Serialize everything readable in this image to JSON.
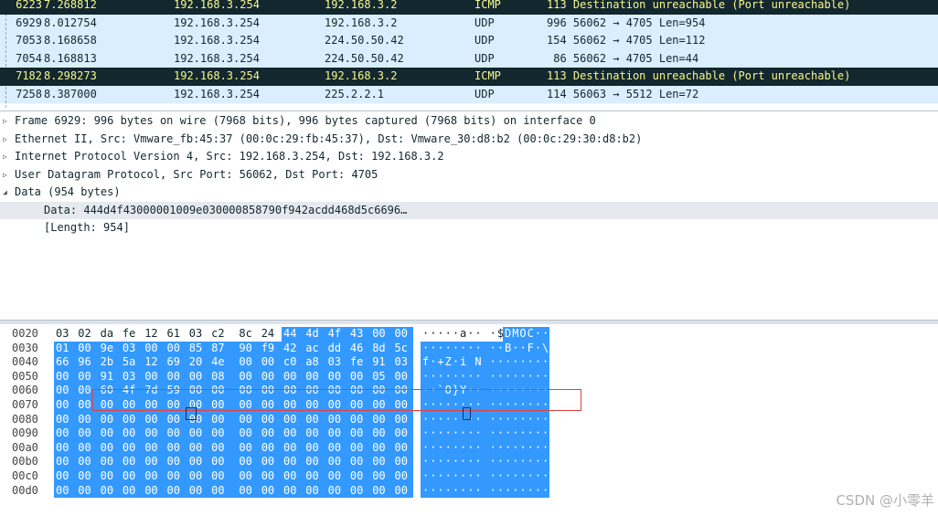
{
  "packet_list": [
    {
      "no": "6223",
      "time": "7.268812",
      "src": "192.168.3.254",
      "dst": "192.168.3.2",
      "proto": "ICMP",
      "len": "113",
      "info": "Destination unreachable (Port unreachable)",
      "kind": "icmp"
    },
    {
      "no": "6929",
      "time": "8.012754",
      "src": "192.168.3.254",
      "dst": "192.168.3.2",
      "proto": "UDP",
      "len": "996",
      "info": "56062 → 4705 Len=954",
      "kind": "udp"
    },
    {
      "no": "7053",
      "time": "8.168658",
      "src": "192.168.3.254",
      "dst": "224.50.50.42",
      "proto": "UDP",
      "len": "154",
      "info": "56062 → 4705 Len=112",
      "kind": "udp"
    },
    {
      "no": "7054",
      "time": "8.168813",
      "src": "192.168.3.254",
      "dst": "224.50.50.42",
      "proto": "UDP",
      "len": " 86",
      "info": "56062 → 4705 Len=44",
      "kind": "udp"
    },
    {
      "no": "7182",
      "time": "8.298273",
      "src": "192.168.3.254",
      "dst": "192.168.3.2",
      "proto": "ICMP",
      "len": "113",
      "info": "Destination unreachable (Port unreachable)",
      "kind": "icmp"
    },
    {
      "no": "7258",
      "time": "8.387000",
      "src": "192.168.3.254",
      "dst": "225.2.2.1",
      "proto": "UDP",
      "len": "114",
      "info": "56063 → 5512 Len=72",
      "kind": "udp"
    }
  ],
  "details": [
    {
      "text": "Frame 6929: 996 bytes on wire (7968 bits), 996 bytes captured (7968 bits) on interface 0",
      "expander": "▷",
      "child": false
    },
    {
      "text": "Ethernet II, Src: Vmware_fb:45:37 (00:0c:29:fb:45:37), Dst: Vmware_30:d8:b2 (00:0c:29:30:d8:b2)",
      "expander": "▷",
      "child": false
    },
    {
      "text": "Internet Protocol Version 4, Src: 192.168.3.254, Dst: 192.168.3.2",
      "expander": "▷",
      "child": false
    },
    {
      "text": "User Datagram Protocol, Src Port: 56062, Dst Port: 4705",
      "expander": "▷",
      "child": false
    },
    {
      "text": "Data (954 bytes)",
      "expander": "◢",
      "child": false
    },
    {
      "text": "Data: 444d4f43000001009e030000858790f942acdd468d5c6696…",
      "expander": "",
      "child": true,
      "highlight": true
    },
    {
      "text": "[Length: 954]",
      "expander": "",
      "child": true
    }
  ],
  "bytes": [
    {
      "offset": "0020",
      "hex": [
        "03",
        "02",
        "da",
        "fe",
        "12",
        "61",
        "03",
        "c2",
        "8c",
        "24",
        "44",
        "4d",
        "4f",
        "43",
        "00",
        "00"
      ],
      "ascii": [
        "·",
        "·",
        "·",
        "·",
        "·",
        "a",
        "·",
        "·",
        "·",
        "$",
        "D",
        "M",
        "O",
        "C",
        "·",
        "·"
      ],
      "sel_from": 10
    },
    {
      "offset": "0030",
      "hex": [
        "01",
        "00",
        "9e",
        "03",
        "00",
        "00",
        "85",
        "87",
        "90",
        "f9",
        "42",
        "ac",
        "dd",
        "46",
        "8d",
        "5c"
      ],
      "ascii": [
        "·",
        "·",
        "·",
        "·",
        "·",
        "·",
        "·",
        "·",
        "·",
        "·",
        "B",
        "·",
        "·",
        "F",
        "·",
        "\\"
      ],
      "sel_from": 0
    },
    {
      "offset": "0040",
      "hex": [
        "66",
        "96",
        "2b",
        "5a",
        "12",
        "69",
        "20",
        "4e",
        "00",
        "00",
        "c0",
        "a8",
        "03",
        "fe",
        "91",
        "03"
      ],
      "ascii": [
        "f",
        "·",
        "+",
        "Z",
        "·",
        "i",
        " ",
        "N",
        "·",
        "·",
        "·",
        "·",
        "·",
        "·",
        "·",
        "·"
      ],
      "sel_from": 0
    },
    {
      "offset": "0050",
      "hex": [
        "00",
        "00",
        "91",
        "03",
        "00",
        "00",
        "00",
        "08",
        "00",
        "00",
        "00",
        "00",
        "00",
        "00",
        "05",
        "00"
      ],
      "ascii": [
        "·",
        "·",
        "·",
        "·",
        "·",
        "·",
        "·",
        "·",
        "·",
        "·",
        "·",
        "·",
        "·",
        "·",
        "·",
        "·"
      ],
      "sel_from": 0
    },
    {
      "offset": "0060",
      "hex": [
        "00",
        "00",
        "60",
        "4f",
        "7d",
        "59",
        "00",
        "00",
        "00",
        "00",
        "00",
        "00",
        "00",
        "00",
        "00",
        "00"
      ],
      "ascii": [
        "·",
        "·",
        "`",
        "O",
        "}",
        "Y",
        "·",
        "·",
        "·",
        "·",
        "·",
        "·",
        "·",
        "·",
        "·",
        "·"
      ],
      "sel_from": 0
    },
    {
      "offset": "0070",
      "hex": [
        "00",
        "00",
        "00",
        "00",
        "00",
        "00",
        "00",
        "00",
        "00",
        "00",
        "00",
        "00",
        "00",
        "00",
        "00",
        "00"
      ],
      "ascii": [
        "·",
        "·",
        "·",
        "·",
        "·",
        "·",
        "·",
        "·",
        "·",
        "·",
        "·",
        "·",
        "·",
        "·",
        "·",
        "·"
      ],
      "sel_from": 0
    },
    {
      "offset": "0080",
      "hex": [
        "00",
        "00",
        "00",
        "00",
        "00",
        "00",
        "00",
        "00",
        "00",
        "00",
        "00",
        "00",
        "00",
        "00",
        "00",
        "00"
      ],
      "ascii": [
        "·",
        "·",
        "·",
        "·",
        "·",
        "·",
        "·",
        "·",
        "·",
        "·",
        "·",
        "·",
        "·",
        "·",
        "·",
        "·"
      ],
      "sel_from": 0
    },
    {
      "offset": "0090",
      "hex": [
        "00",
        "00",
        "00",
        "00",
        "00",
        "00",
        "00",
        "00",
        "00",
        "00",
        "00",
        "00",
        "00",
        "00",
        "00",
        "00"
      ],
      "ascii": [
        "·",
        "·",
        "·",
        "·",
        "·",
        "·",
        "·",
        "·",
        "·",
        "·",
        "·",
        "·",
        "·",
        "·",
        "·",
        "·"
      ],
      "sel_from": 0
    },
    {
      "offset": "00a0",
      "hex": [
        "00",
        "00",
        "00",
        "00",
        "00",
        "00",
        "00",
        "00",
        "00",
        "00",
        "00",
        "00",
        "00",
        "00",
        "00",
        "00"
      ],
      "ascii": [
        "·",
        "·",
        "·",
        "·",
        "·",
        "·",
        "·",
        "·",
        "·",
        "·",
        "·",
        "·",
        "·",
        "·",
        "·",
        "·"
      ],
      "sel_from": 0
    },
    {
      "offset": "00b0",
      "hex": [
        "00",
        "00",
        "00",
        "00",
        "00",
        "00",
        "00",
        "00",
        "00",
        "00",
        "00",
        "00",
        "00",
        "00",
        "00",
        "00"
      ],
      "ascii": [
        "·",
        "·",
        "·",
        "·",
        "·",
        "·",
        "·",
        "·",
        "·",
        "·",
        "·",
        "·",
        "·",
        "·",
        "·",
        "·"
      ],
      "sel_from": 0
    },
    {
      "offset": "00c0",
      "hex": [
        "00",
        "00",
        "00",
        "00",
        "00",
        "00",
        "00",
        "00",
        "00",
        "00",
        "00",
        "00",
        "00",
        "00",
        "00",
        "00"
      ],
      "ascii": [
        "·",
        "·",
        "·",
        "·",
        "·",
        "·",
        "·",
        "·",
        "·",
        "·",
        "·",
        "·",
        "·",
        "·",
        "·",
        "·"
      ],
      "sel_from": 0
    },
    {
      "offset": "00d0",
      "hex": [
        "00",
        "00",
        "00",
        "00",
        "00",
        "00",
        "00",
        "00",
        "00",
        "00",
        "00",
        "00",
        "00",
        "00",
        "00",
        "00"
      ],
      "ascii": [
        "·",
        "·",
        "·",
        "·",
        "·",
        "·",
        "·",
        "·",
        "·",
        "·",
        "·",
        "·",
        "·",
        "·",
        "·",
        "·"
      ],
      "sel_from": 0
    }
  ],
  "watermark": "CSDN @小零羊",
  "colors": {
    "icmp_bg": "#12272e",
    "icmp_fg": "#f7f78f",
    "udp_bg": "#daeeff",
    "byte_select": "#3399ff",
    "annotation": "#e0413e"
  }
}
